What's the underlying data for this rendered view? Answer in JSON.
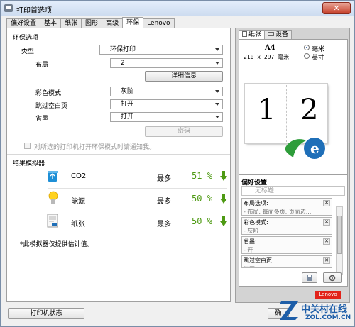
{
  "window": {
    "title": "打印首选项",
    "close_label": "✕"
  },
  "tabs": [
    "偏好设置",
    "基本",
    "纸张",
    "图形",
    "高级",
    "环保",
    "Lenovo"
  ],
  "active_tab": "环保",
  "eco": {
    "section_title": "环保选项",
    "type_label": "类型",
    "type_value": "环保打印",
    "layout_label": "布局",
    "layout_value": "2",
    "details_button": "详细信息",
    "color_mode_label": "彩色模式",
    "color_mode_value": "灰阶",
    "skip_blank_label": "跳过空白页",
    "skip_blank_value": "打开",
    "toner_save_label": "省墨",
    "toner_save_value": "打开",
    "password_button": "密码",
    "notify_checkbox_label": "对所选的打印机打开环保模式时请通知我。"
  },
  "simulator": {
    "title": "结果模拟器",
    "rows": [
      {
        "icon": "recycle-bin-icon",
        "label": "CO2",
        "most": "最多",
        "percent": "51",
        "unit": "%"
      },
      {
        "icon": "light-bulb-icon",
        "label": "能源",
        "most": "最多",
        "percent": "50",
        "unit": "%"
      },
      {
        "icon": "paper-sheet-icon",
        "label": "纸张",
        "most": "最多",
        "percent": "50",
        "unit": "%"
      }
    ],
    "note": "*此模拟器仅提供估计值。"
  },
  "right": {
    "tabs": [
      "纸张",
      "设备"
    ],
    "paper_size": "A4",
    "paper_dims": "210 x 297 毫米",
    "unit_mm": "毫米",
    "unit_inch": "英寸",
    "page_numbers": [
      "1",
      "2"
    ],
    "preferences_title": "偏好设置",
    "untitled": "无标题",
    "pref_items": [
      {
        "title": "布局选项:",
        "value": "- 布局: 每面多页, 页面边..."
      },
      {
        "title": "彩色模式:",
        "value": "- 灰阶"
      },
      {
        "title": "省墨:",
        "value": "- 开"
      },
      {
        "title": "跳过空白页:",
        "value": "打开"
      }
    ],
    "logo_text": "Lenovo"
  },
  "bottom": {
    "printer_status_button": "打印机状态",
    "ok_button": "确"
  },
  "watermark": {
    "text1": "中关村在线",
    "text2": "ZOL.COM.CN"
  },
  "colors": {
    "accent_green": "#4e9a13",
    "lenovo_red": "#e2231a",
    "eco_green": "#2e9d3a",
    "eco_blue": "#1f6fb8"
  }
}
